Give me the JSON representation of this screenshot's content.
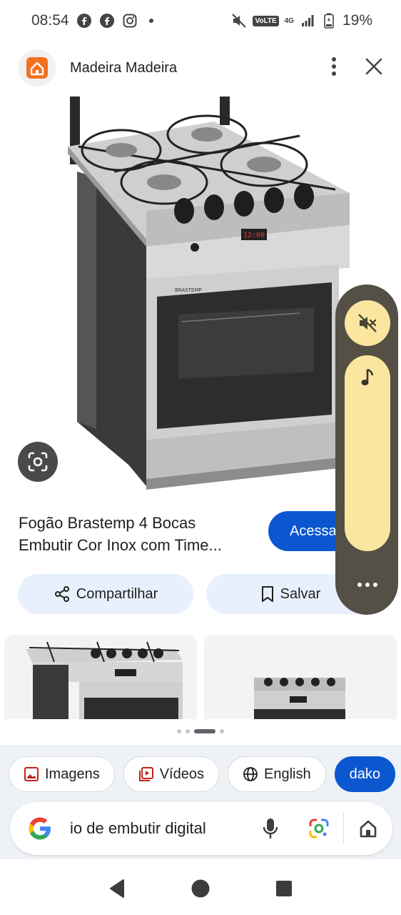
{
  "status_bar": {
    "time": "08:54",
    "battery": "19%",
    "volte": "VoLTE",
    "network": "4G"
  },
  "header": {
    "site_name": "Madeira Madeira"
  },
  "product": {
    "title_line1": "Fogão Brastemp 4 Bocas",
    "title_line2": "Embutir Cor Inox com Time...",
    "visit_label": "Acessar",
    "brand_on_image": "BRASTEMP",
    "display_on_image": "12:00"
  },
  "actions": {
    "share_label": "Compartilhar",
    "save_label": "Salvar"
  },
  "chips": [
    {
      "label": "Imagens",
      "icon": "image-icon"
    },
    {
      "label": "Vídeos",
      "icon": "video-icon"
    },
    {
      "label": "English",
      "icon": "globe-icon"
    },
    {
      "label": "dako",
      "icon": ""
    }
  ],
  "search": {
    "query": "io de embutir digital"
  },
  "colors": {
    "accent_blue": "#0b57d0",
    "chip_bg": "#e8f0fe",
    "media_panel": "#545045",
    "media_pill": "#fbe6a0",
    "site_logo_orange": "#f37021"
  }
}
